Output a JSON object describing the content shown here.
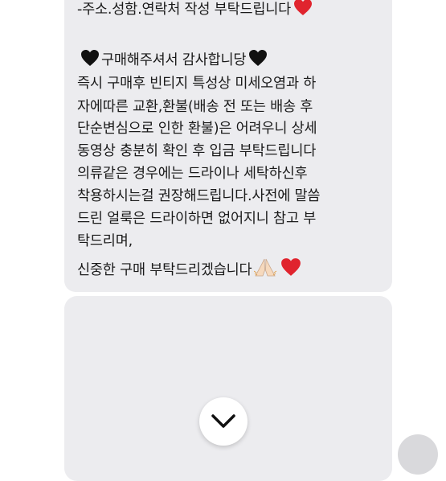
{
  "message": {
    "lines": [
      "-주소.성함.연락처 작성 부탁드립니다",
      "구매해주셔서 감사합니당",
      "즉시 구매후 빈티지 특성상 미세오염과 하",
      "자에따른 교환,환불(배송 전 또는 배송 후",
      "단순변심으로 인한 환불)은 어려우니 상세",
      "동영상 충분히 확인 후 입금 부탁드립니다",
      "의류같은 경우에는 드라이나 세탁하신후",
      "착용하시는걸 권장해드립니다.사전에 말씀",
      "드린 얼룩은 드라이하면 없어지니 참고 부",
      "탁드리며,",
      "신중한 구매 부탁드리겠습니다"
    ],
    "icons": [
      "red-heart-icon",
      "black-heart-icon",
      "praying-hands-icon"
    ]
  },
  "colors": {
    "bubble": "#ececef",
    "heart_red": "#e0242e",
    "heart_black": "#111111"
  },
  "controls": {
    "scroll_down": "chevron-down-icon"
  }
}
